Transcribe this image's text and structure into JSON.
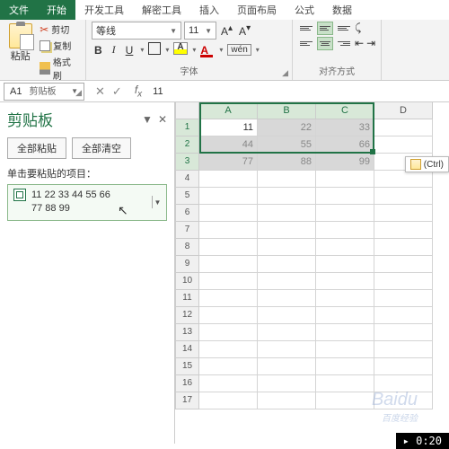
{
  "tabs": {
    "file": "文件",
    "home": "开始",
    "dev": "开发工具",
    "dec": "解密工具",
    "insert": "插入",
    "layout": "页面布局",
    "formula": "公式",
    "data": "数据"
  },
  "clipboard": {
    "paste": "粘贴",
    "cut": "剪切",
    "copy": "复制",
    "brush": "格式刷",
    "group": "剪贴板"
  },
  "font": {
    "name": "等线",
    "size": "11",
    "wen": "wén",
    "group": "字体"
  },
  "align": {
    "group": "对齐方式"
  },
  "fbar": {
    "ref": "A1",
    "value": "11"
  },
  "pane": {
    "title": "剪贴板",
    "paste_all": "全部粘贴",
    "clear_all": "全部清空",
    "hint": "单击要粘贴的项目：",
    "item_l1": "11 22 33 44 55 66",
    "item_l2": "77 88 99"
  },
  "cols": [
    "A",
    "B",
    "C",
    "D"
  ],
  "cells": {
    "r1": [
      "11",
      "22",
      "33"
    ],
    "r2": [
      "44",
      "55",
      "66"
    ],
    "r3": [
      "77",
      "88",
      "99"
    ]
  },
  "ctrl": "(Ctrl)",
  "watermark": "Baidu",
  "watermark_sub": "百度经验",
  "timer": "0:20"
}
